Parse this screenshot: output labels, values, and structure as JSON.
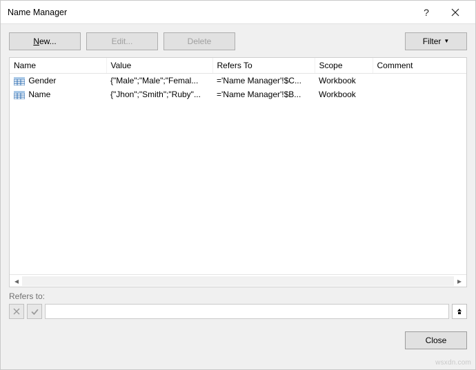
{
  "titlebar": {
    "title": "Name Manager"
  },
  "toolbar": {
    "new_label_pre": "N",
    "new_label_post": "ew...",
    "edit_label": "Edit...",
    "delete_label": "Delete",
    "filter_label": "Filter"
  },
  "columns": {
    "c0": "Name",
    "c1": "Value",
    "c2": "Refers To",
    "c3": "Scope",
    "c4": "Comment"
  },
  "rows": [
    {
      "name": "Gender",
      "value": "{\"Male\";\"Male\";\"Femal...",
      "refers": "='Name Manager'!$C...",
      "scope": "Workbook",
      "comment": ""
    },
    {
      "name": "Name",
      "value": "{\"Jhon\";\"Smith\";\"Ruby\"...",
      "refers": "='Name Manager'!$B...",
      "scope": "Workbook",
      "comment": ""
    }
  ],
  "refersto": {
    "label": "Refers to:",
    "value": ""
  },
  "footer": {
    "close_label": "Close"
  },
  "watermark": "wsxdn.com"
}
